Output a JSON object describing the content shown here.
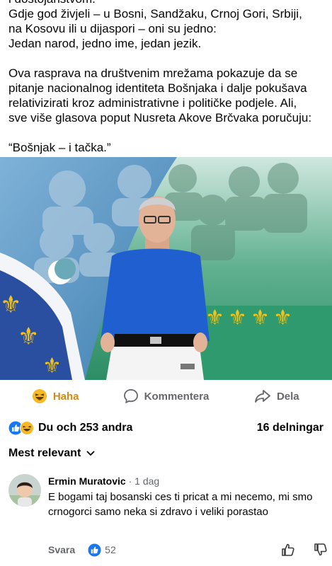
{
  "post": {
    "cut_line": "i dostojanstvom.",
    "lines": [
      "Gdje god živjeli – u Bosni, Sandžaku, Crnoj Gori, Srbiji,",
      "na Kosovu ili u dijaspori – oni su jedno:",
      "Jedan narod, jedno ime, jedan jezik."
    ],
    "para2": [
      "Ova rasprava na društvenim mrežama pokazuje da se",
      "pitanje nacionalnog identiteta Bošnjaka i dalje pokušava",
      "relativizirati kroz administrativne i političke podjele. Ali,",
      "sve više glasova poput Nusreta Akove Brčvaka poručuju:"
    ],
    "quote": "“Bošnjak – i tačka.”"
  },
  "actions": {
    "haha": "Haha",
    "comment": "Kommentera",
    "share": "Dela"
  },
  "reactions": {
    "text": "Du och 253 andra",
    "shares": "16 delningar"
  },
  "sort": {
    "label": "Mest relevant"
  },
  "comment": {
    "author": "Ermin Muratovic",
    "sep": " · ",
    "time": "1 dag",
    "text": "E bogami taj bosanski ces ti pricat a mi necemo, mi smo crnogorci samo neka si zdravo i veliki porastao",
    "reply": "Svara",
    "likes": "52"
  },
  "colors": {
    "accent_blue": "#1877f2",
    "haha_yellow": "#f7b928",
    "flag_blue": "#2a4ea0",
    "lily_gold": "#f2c41b",
    "flag_green": "#2f9a6e",
    "shirt_blue": "#1f5fd0"
  }
}
